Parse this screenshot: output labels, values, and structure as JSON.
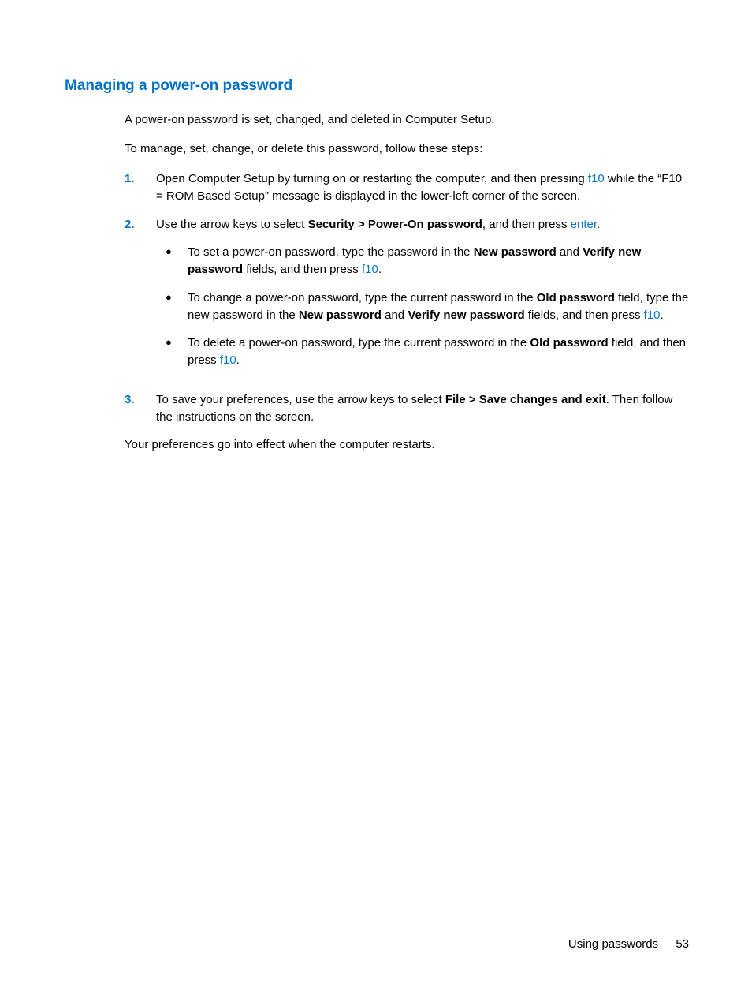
{
  "heading": "Managing a power-on password",
  "intro1": "A power-on password is set, changed, and deleted in Computer Setup.",
  "intro2": "To manage, set, change, or delete this password, follow these steps:",
  "steps": {
    "n1": "1.",
    "n2": "2.",
    "n3": "3.",
    "s1a": "Open Computer Setup by turning on or restarting the computer, and then pressing ",
    "s1_f10": "f10",
    "s1b": " while the “F10 = ROM Based Setup” message is displayed in the lower-left corner of the screen.",
    "s2a": "Use the arrow keys to select ",
    "s2_bold": "Security > Power-On password",
    "s2b": ", and then press ",
    "s2_enter": "enter",
    "s2c": ".",
    "b1a": "To set a power-on password, type the password in the ",
    "b1_bold1": "New password",
    "b1b": " and ",
    "b1_bold2": "Verify new password",
    "b1c": " fields, and then press ",
    "b1_f10": "f10",
    "b1d": ".",
    "b2a": "To change a power-on password, type the current password in the ",
    "b2_bold1": "Old password",
    "b2b": " field, type the new password in the ",
    "b2_bold2": "New password",
    "b2c": " and ",
    "b2_bold3": "Verify new password",
    "b2d": " fields, and then press ",
    "b2_f10": "f10",
    "b2e": ".",
    "b3a": "To delete a power-on password, type the current password in the ",
    "b3_bold1": "Old password",
    "b3b": " field, and then press ",
    "b3_f10": "f10",
    "b3c": ".",
    "s3a": "To save your preferences, use the arrow keys to select ",
    "s3_bold": "File > Save changes and exit",
    "s3b": ". Then follow the instructions on the screen."
  },
  "closing": "Your preferences go into effect when the computer restarts.",
  "footer_section": "Using passwords",
  "footer_page": "53"
}
